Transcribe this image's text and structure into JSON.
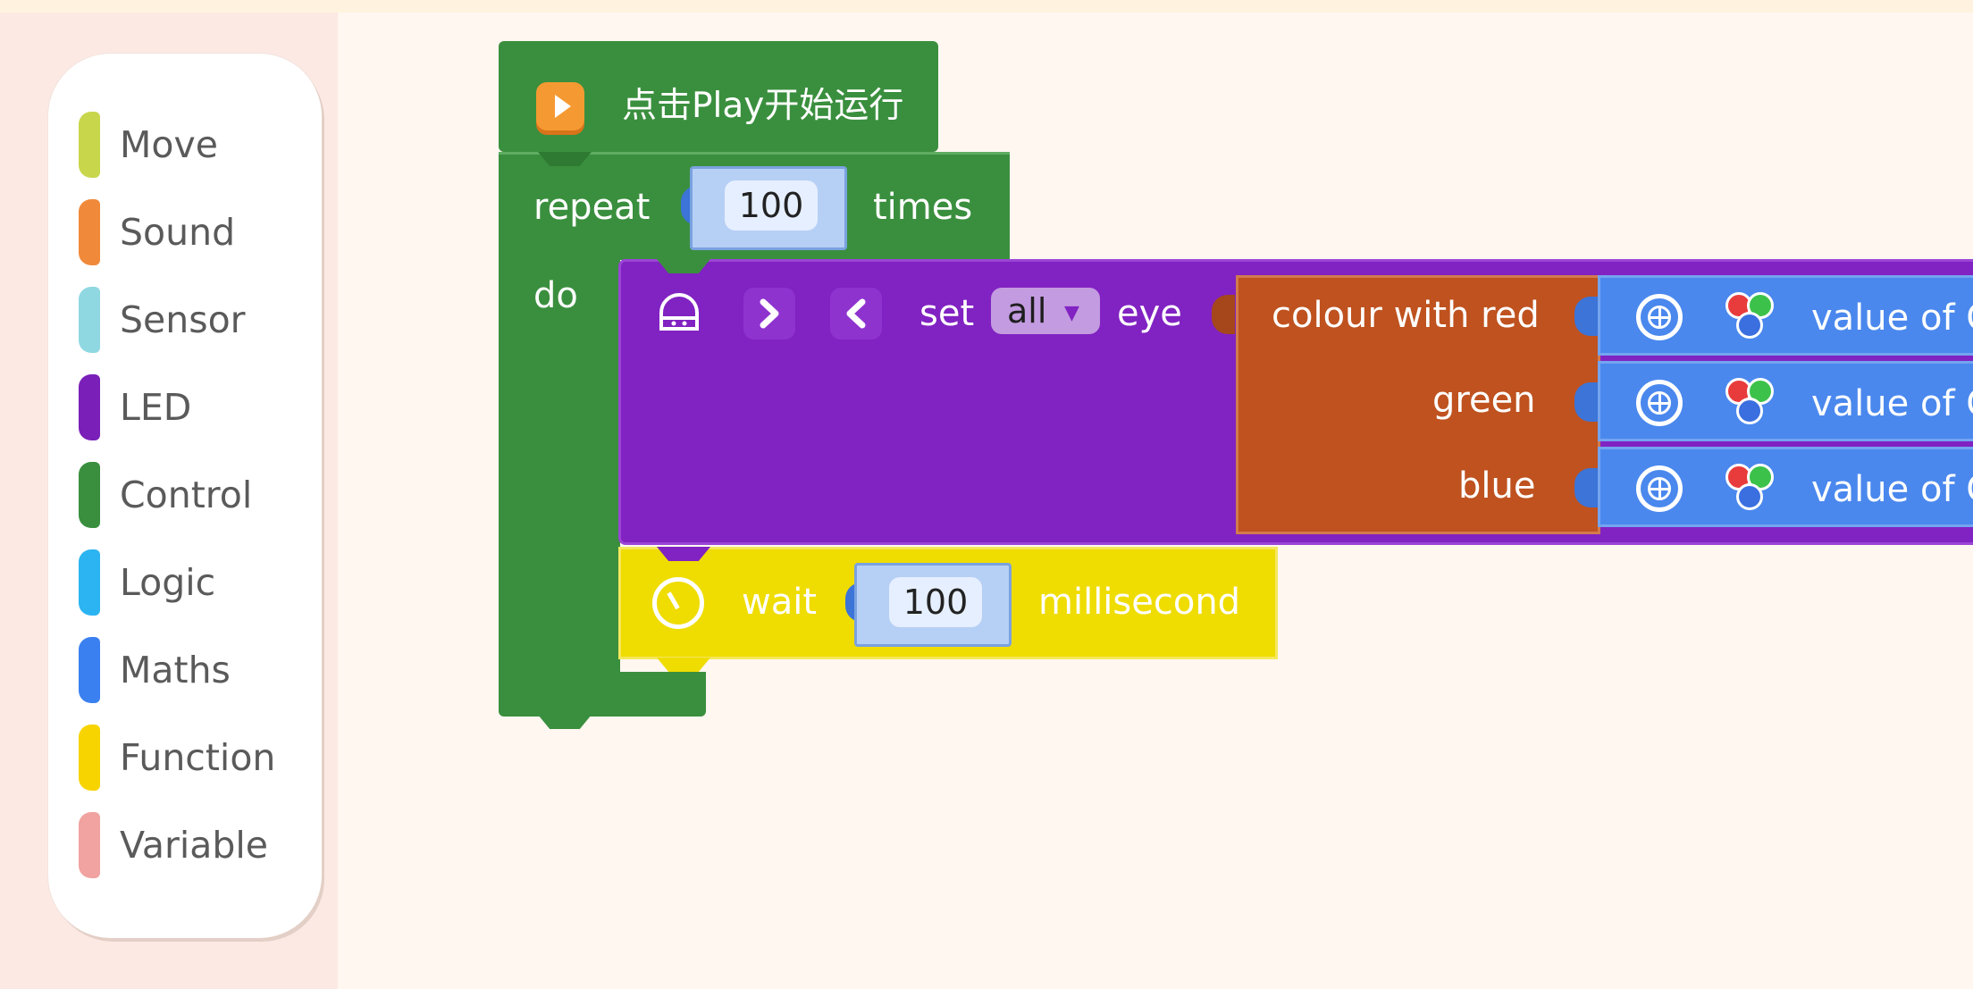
{
  "categories": [
    {
      "label": "Move",
      "color": "#c8d64b"
    },
    {
      "label": "Sound",
      "color": "#f08a3a"
    },
    {
      "label": "Sensor",
      "color": "#8fd8e2"
    },
    {
      "label": "LED",
      "color": "#7a20b8"
    },
    {
      "label": "Control",
      "color": "#3a8f3e"
    },
    {
      "label": "Logic",
      "color": "#2cb4f2"
    },
    {
      "label": "Maths",
      "color": "#3b80f0"
    },
    {
      "label": "Function",
      "color": "#f7d400"
    },
    {
      "label": "Variable",
      "color": "#f0a3a0"
    }
  ],
  "start_block": {
    "label": "点击Play开始运行",
    "icon": "play-icon"
  },
  "repeat_block": {
    "repeat_label": "repeat",
    "count": "100",
    "times_label": "times",
    "do_label": "do"
  },
  "set_eye_block": {
    "icons": [
      "robot-icon",
      "right-eye-icon",
      "left-eye-icon"
    ],
    "set_label": "set",
    "target_value": "all",
    "eye_label": "eye"
  },
  "colour_block": {
    "red_label": "colour with red",
    "green_label": "green",
    "blue_label": "blue"
  },
  "value_blocks": [
    {
      "label": "value of C",
      "icons": [
        "sensor-port-icon",
        "rgb-icon"
      ]
    },
    {
      "label": "value of C",
      "icons": [
        "sensor-port-icon",
        "rgb-icon"
      ]
    },
    {
      "label": "value of C",
      "icons": [
        "sensor-port-icon",
        "rgb-icon"
      ]
    }
  ],
  "wait_block": {
    "wait_label": "wait",
    "value": "100",
    "unit_label": "millisecond",
    "icon": "timer-icon"
  }
}
